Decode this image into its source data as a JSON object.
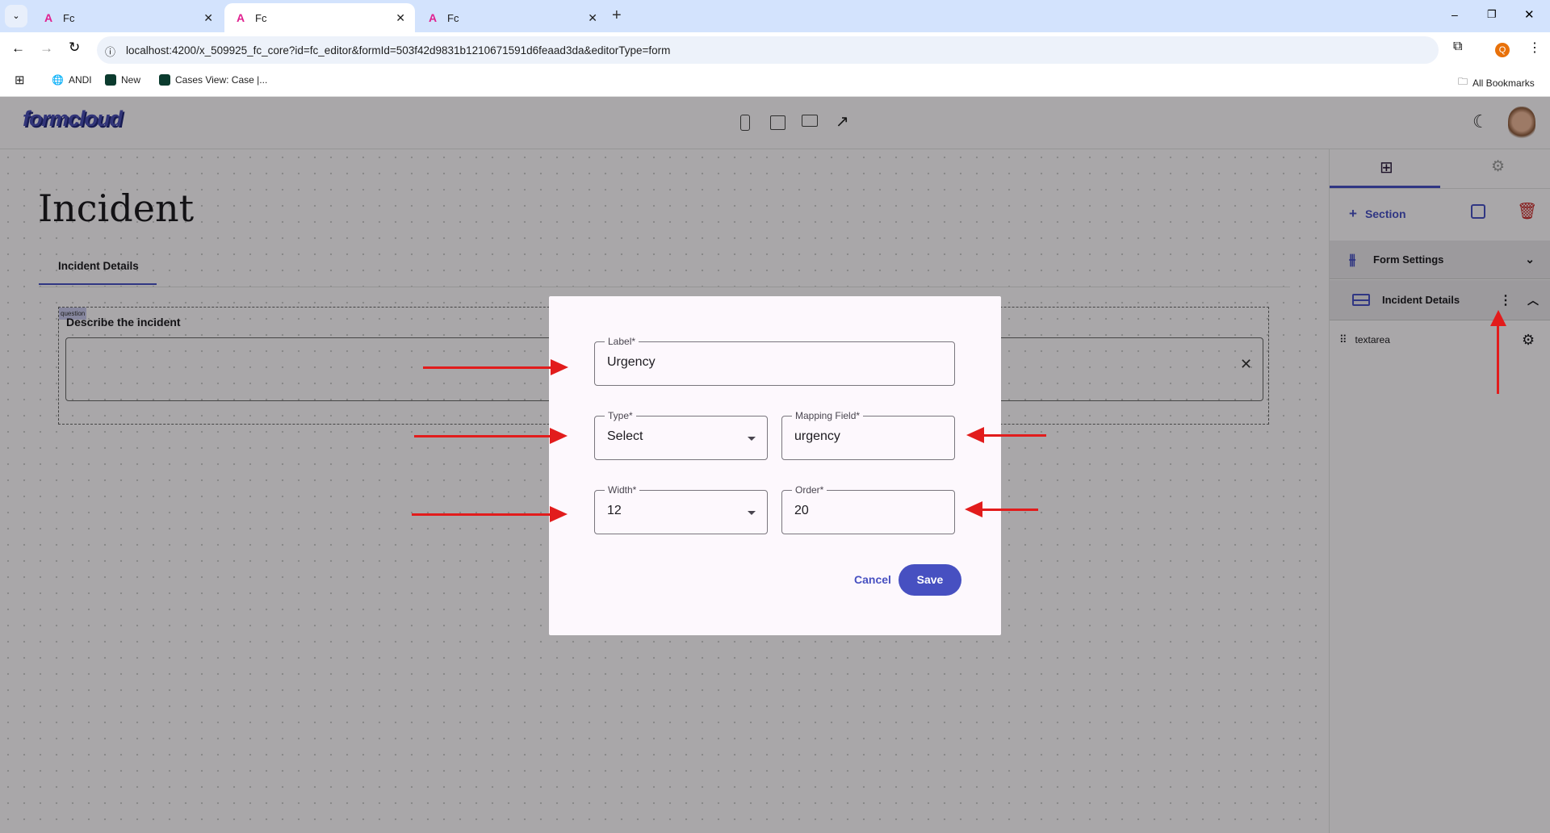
{
  "browser": {
    "tabs": [
      {
        "title": "Fc"
      },
      {
        "title": "Fc"
      },
      {
        "title": "Fc"
      }
    ],
    "url": "localhost:4200/x_509925_fc_core?id=fc_editor&formId=503f42d9831b1210671591d6feaad3da&editorType=form",
    "bookmarks": [
      "ANDI",
      "New",
      "Cases View: Case |..."
    ],
    "all_bookmarks": "All Bookmarks",
    "profile_initial": "Q"
  },
  "app": {
    "logo": "formcloud"
  },
  "form": {
    "title": "Incident",
    "tab": "Incident Details",
    "question_tag": "question",
    "question_label": "Describe the incident"
  },
  "panel": {
    "add_section": "Section",
    "form_settings": "Form Settings",
    "section_name": "Incident Details",
    "item": "textarea"
  },
  "dialog": {
    "label_label": "Label*",
    "label_value": "Urgency",
    "type_label": "Type*",
    "type_value": "Select",
    "mapping_label": "Mapping Field*",
    "mapping_value": "urgency",
    "width_label": "Width*",
    "width_value": "12",
    "order_label": "Order*",
    "order_value": "20",
    "cancel": "Cancel",
    "save": "Save"
  },
  "colors": {
    "accent": "#4750c1",
    "annotation": "#e21c1c",
    "delete": "#c62828"
  }
}
